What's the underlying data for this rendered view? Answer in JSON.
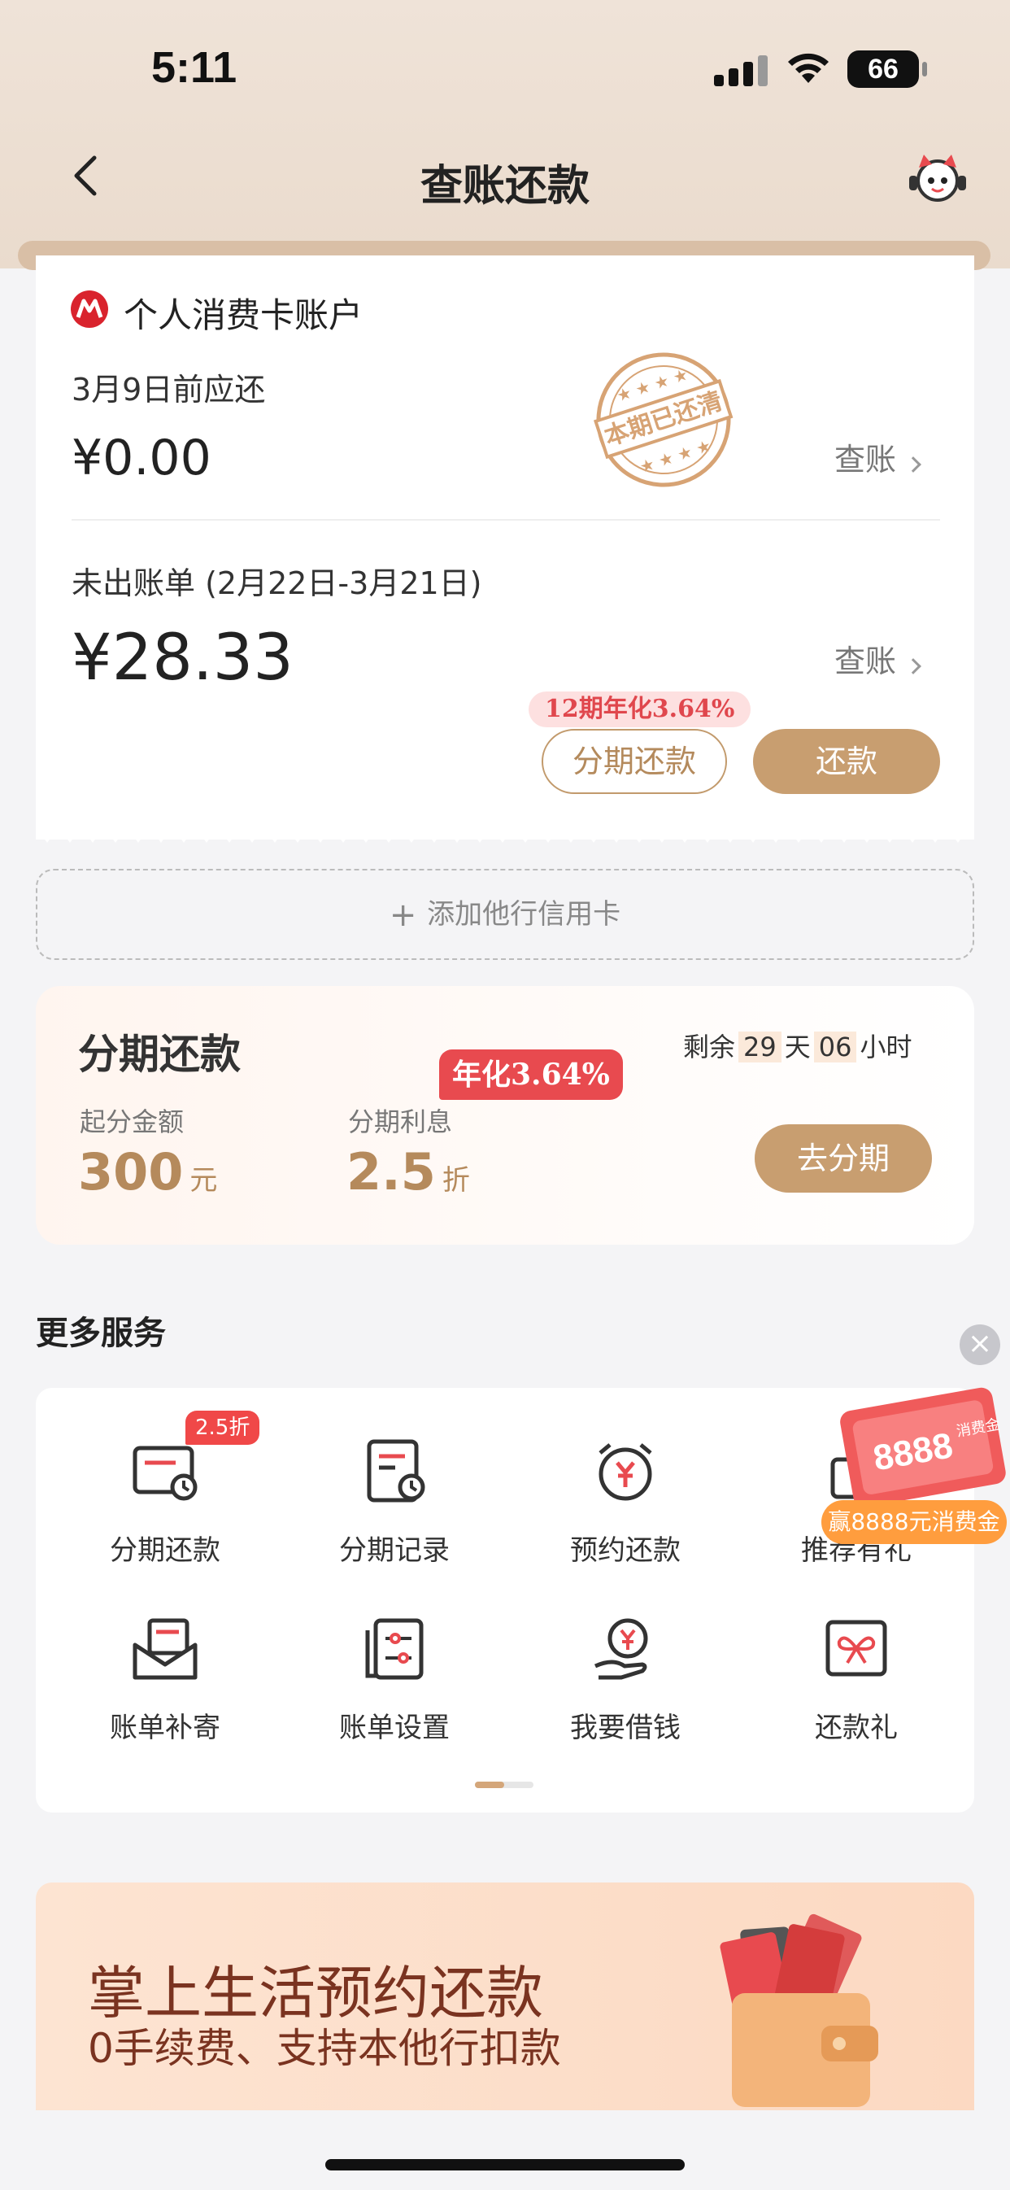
{
  "status_bar": {
    "time": "5:11",
    "battery": "66"
  },
  "nav": {
    "title": "查账还款"
  },
  "account": {
    "name": "个人消费卡账户"
  },
  "current_bill": {
    "due_label": "3月9日前应还",
    "amount": "¥0.00",
    "view_label": "查账",
    "stamp_text": "本期已还清"
  },
  "unbilled": {
    "label": "未出账单 (2月22日-3月21日)",
    "amount": "¥28.33",
    "view_label": "查账",
    "promo_tag": "12期年化3.64%",
    "installment_button": "分期还款",
    "repay_button": "还款"
  },
  "add_card": {
    "label": "添加他行信用卡"
  },
  "installment_card": {
    "title": "分期还款",
    "remaining_prefix": "剩余",
    "remaining_days": "29",
    "days_unit": "天",
    "remaining_hours": "06",
    "hours_unit": "小时",
    "rate_tag": "年化3.64%",
    "min_amount_label": "起分金额",
    "min_amount_value": "300",
    "min_amount_unit": "元",
    "interest_label": "分期利息",
    "interest_value": "2.5",
    "interest_unit": "折",
    "go_button": "去分期"
  },
  "more_services": {
    "title": "更多服务",
    "badge": "2.5折",
    "items": [
      {
        "label": "分期还款",
        "icon": "installment-icon"
      },
      {
        "label": "分期记录",
        "icon": "record-icon"
      },
      {
        "label": "预约还款",
        "icon": "alarm-yen-icon"
      },
      {
        "label": "推荐有礼",
        "icon": "gift-icon"
      },
      {
        "label": "账单补寄",
        "icon": "mail-icon"
      },
      {
        "label": "账单设置",
        "icon": "settings-doc-icon"
      },
      {
        "label": "我要借钱",
        "icon": "borrow-icon"
      },
      {
        "label": "还款礼",
        "icon": "repay-gift-icon"
      }
    ],
    "page_position": 0.5
  },
  "floating_promo": {
    "amount": "8888",
    "label": "赢8888元消费金",
    "side_text": "消费金"
  },
  "banner": {
    "headline": "掌上生活预约还款",
    "subline": "0手续费、支持本他行扣款"
  },
  "colors": {
    "accent": "#c89e70",
    "red": "#e84a4f",
    "background": "#f4f4f6"
  }
}
